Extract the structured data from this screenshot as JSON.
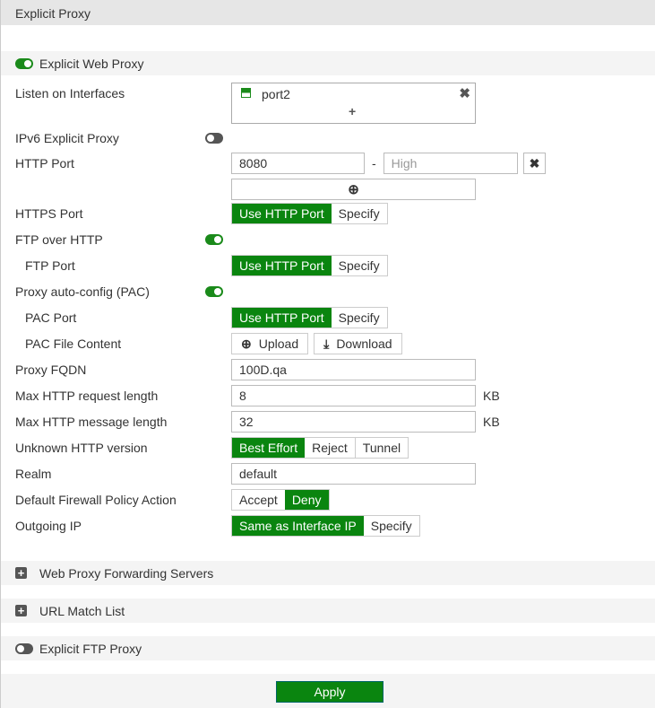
{
  "header": {
    "title": "Explicit Proxy"
  },
  "web_proxy": {
    "title": "Explicit Web Proxy",
    "enabled": true
  },
  "listen": {
    "label": "Listen on Interfaces",
    "interface": "port2",
    "add": "+"
  },
  "ipv6": {
    "label": "IPv6 Explicit Proxy",
    "enabled": false
  },
  "http_port": {
    "label": "HTTP Port",
    "value": "8080",
    "sep": "-",
    "high_placeholder": "High"
  },
  "https_port": {
    "label": "HTTPS Port",
    "options": [
      "Use HTTP Port",
      "Specify"
    ]
  },
  "ftp_over_http": {
    "label": "FTP over HTTP",
    "enabled": true
  },
  "ftp_port": {
    "label": "FTP Port",
    "options": [
      "Use HTTP Port",
      "Specify"
    ]
  },
  "pac": {
    "label": "Proxy auto-config (PAC)",
    "enabled": true
  },
  "pac_port": {
    "label": "PAC Port",
    "options": [
      "Use HTTP Port",
      "Specify"
    ]
  },
  "pac_file": {
    "label": "PAC File Content",
    "upload": "Upload",
    "download": "Download"
  },
  "fqdn": {
    "label": "Proxy FQDN",
    "value": "100D.qa"
  },
  "max_req": {
    "label": "Max HTTP request length",
    "value": "8",
    "unit": "KB"
  },
  "max_msg": {
    "label": "Max HTTP message length",
    "value": "32",
    "unit": "KB"
  },
  "unknown": {
    "label": "Unknown HTTP version",
    "options": [
      "Best Effort",
      "Reject",
      "Tunnel"
    ]
  },
  "realm": {
    "label": "Realm",
    "value": "default"
  },
  "default_action": {
    "label": "Default Firewall Policy Action",
    "options": [
      "Accept",
      "Deny"
    ]
  },
  "outgoing": {
    "label": "Outgoing IP",
    "options": [
      "Same as Interface IP",
      "Specify"
    ]
  },
  "sections": {
    "forwarding": "Web Proxy Forwarding Servers",
    "url_match": "URL Match List",
    "ftp_proxy": "Explicit FTP Proxy"
  },
  "footer": {
    "apply": "Apply"
  },
  "colors": {
    "accent": "#0a850f"
  }
}
